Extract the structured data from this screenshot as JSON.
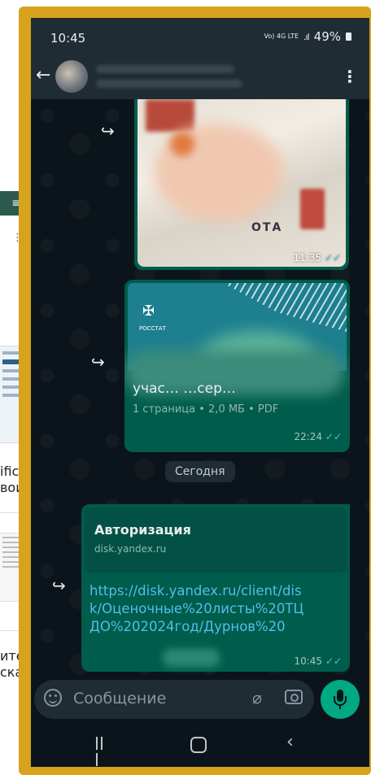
{
  "status_bar": {
    "time": "10:45",
    "network": "Vo) 4G LTE",
    "battery": "49%"
  },
  "header": {
    "back_icon": "arrow-left",
    "menu_icon": "more-vertical"
  },
  "messages": [
    {
      "type": "image",
      "time": "11:35",
      "image_text": "ОТА",
      "status": "read"
    },
    {
      "type": "document",
      "cover_label": "РОССТАТ",
      "title": "учас… …сер…",
      "subtitle": "1 страница • 2,0 МБ • PDF",
      "time": "22:24",
      "status": "read"
    },
    {
      "type": "link",
      "preview_title": "Авторизация",
      "preview_domain": "disk.yandex.ru",
      "text": "https://disk.yandex.ru/client/disk/Оценочные%20листы%20ТЦДО%202024год/Дурнов%20",
      "time": "10:45",
      "status": "read"
    }
  ],
  "date_separator": "Сегодня",
  "input": {
    "placeholder": "Сообщение"
  },
  "colors": {
    "bubble_out": "#005c4b",
    "background": "#0b141a",
    "accent": "#00a884",
    "read_tick": "#53bdeb",
    "frame": "#d7a31c"
  },
  "background_document": {
    "fragments": [
      "ific",
      "вои",
      "ите",
      "ска"
    ]
  }
}
